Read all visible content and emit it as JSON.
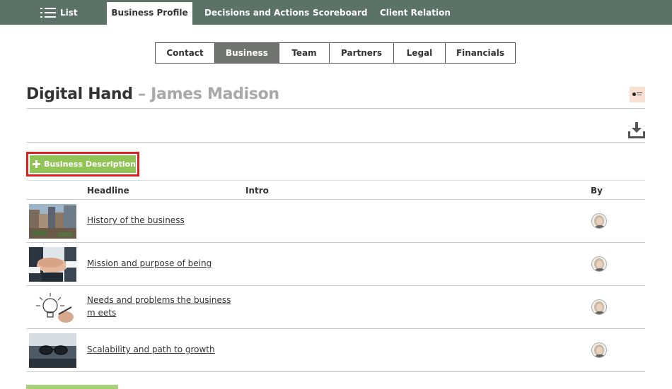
{
  "topnav": {
    "list_label": "List",
    "tabs": [
      {
        "label": "Business Profile",
        "active": true
      },
      {
        "label": "Decisions and Actions",
        "active": false
      },
      {
        "label": "Scoreboard",
        "active": false
      },
      {
        "label": "Client Relation",
        "active": false
      }
    ]
  },
  "subtabs": [
    {
      "label": "Contact",
      "active": false
    },
    {
      "label": "Business",
      "active": true
    },
    {
      "label": "Team",
      "active": false
    },
    {
      "label": "Partners",
      "active": false
    },
    {
      "label": "Legal",
      "active": false
    },
    {
      "label": "Financials",
      "active": false
    }
  ],
  "title": {
    "company": "Digital Hand",
    "separator": " – ",
    "person": "James Madison"
  },
  "add_button": {
    "label": "Business Description",
    "icon": "plus-icon"
  },
  "table": {
    "headers": {
      "headline": "Headline",
      "intro": "Intro",
      "by": "By"
    },
    "rows": [
      {
        "headline": "History of the business",
        "intro": "",
        "thumb": "city-buildings-image"
      },
      {
        "headline": "Mission and purpose of being",
        "intro": "",
        "thumb": "stacked-hands-image"
      },
      {
        "headline": "Needs and problems the business m eets",
        "intro": "",
        "thumb": "lightbulb-sketch-image"
      },
      {
        "headline": "Scalability and path to growth",
        "intro": "",
        "thumb": "glasses-on-desk-image"
      }
    ]
  },
  "colors": {
    "nav_bg": "#5b7366",
    "accent_green": "#92c356",
    "active_subtab": "#707370",
    "highlight_red": "#e02020"
  }
}
